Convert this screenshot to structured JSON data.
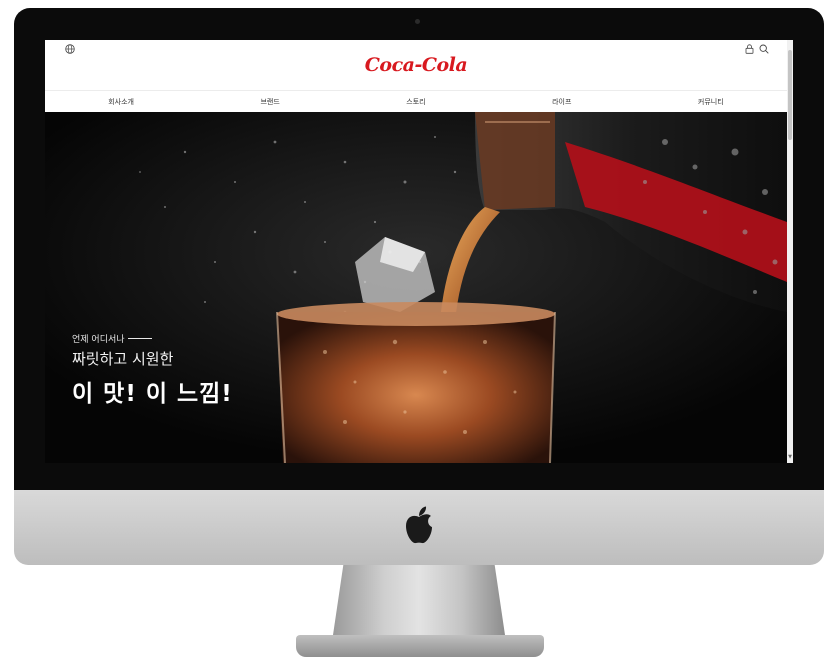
{
  "header": {
    "logo_text": "Coca-Cola",
    "globe_icon": "globe-icon",
    "lock_icon": "lock-icon",
    "search_icon": "search-icon"
  },
  "nav": {
    "items": [
      {
        "label": "회사소개"
      },
      {
        "label": "브랜드"
      },
      {
        "label": "스토리"
      },
      {
        "label": "라이프"
      },
      {
        "label": "커뮤니티"
      }
    ]
  },
  "hero": {
    "kicker": "언제 어디서나",
    "subtitle": "짜릿하고 시원한",
    "title": "이 맛! 이 느낌!"
  },
  "colors": {
    "brand_red": "#d8191f",
    "hero_background": "#050505"
  }
}
